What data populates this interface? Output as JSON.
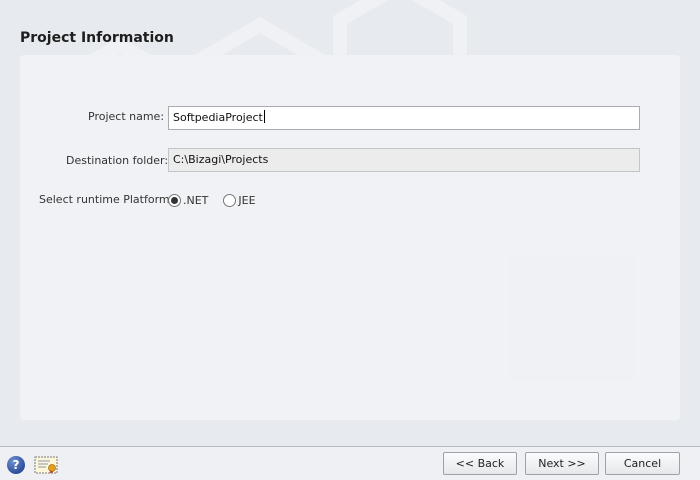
{
  "page": {
    "title": "Project Information"
  },
  "form": {
    "project_name_label": "Project name:",
    "project_name_value": "SoftpediaProject",
    "destination_label": "Destination folder:",
    "destination_value": "C:\\Bizagi\\Projects",
    "platform_label": "Select runtime Platform:",
    "platform_options": [
      {
        "label": ".NET",
        "selected": true
      },
      {
        "label": "JEE",
        "selected": false
      }
    ]
  },
  "footer": {
    "back_label": "<< Back",
    "next_label": "Next >>",
    "cancel_label": "Cancel",
    "help_glyph": "?"
  },
  "icons": {
    "help": "help-icon",
    "certificate": "certificate-icon"
  },
  "colors": {
    "background": "#e7eaef",
    "panel": "#f1f2f5",
    "help_icon": "#2d4f9b"
  }
}
